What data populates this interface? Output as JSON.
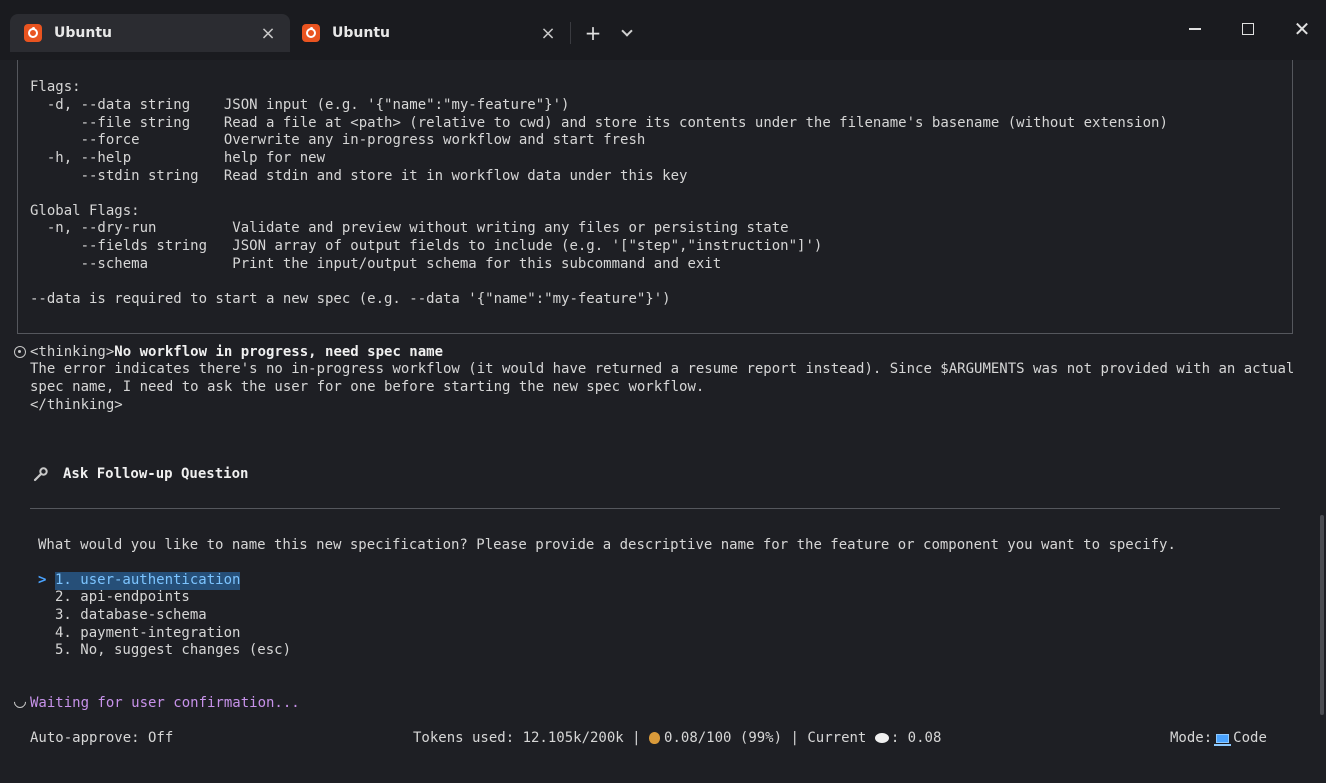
{
  "tabs": [
    {
      "label": "Ubuntu",
      "active": true,
      "icon": "ubuntu-icon"
    },
    {
      "label": "Ubuntu",
      "active": false,
      "icon": "ubuntu-icon"
    }
  ],
  "tab_controls": {
    "new_tab": "+",
    "close": "×",
    "window_close": "✕"
  },
  "help": {
    "flags_heading": "Flags:",
    "flags": [
      {
        "flag": "  -d, --data string    ",
        "desc": "JSON input (e.g. '{\"name\":\"my-feature\"}')"
      },
      {
        "flag": "      --file string    ",
        "desc": "Read a file at <path> (relative to cwd) and store its contents under the filename's basename (without extension)"
      },
      {
        "flag": "      --force          ",
        "desc": "Overwrite any in-progress workflow and start fresh"
      },
      {
        "flag": "  -h, --help           ",
        "desc": "help for new"
      },
      {
        "flag": "      --stdin string   ",
        "desc": "Read stdin and store it in workflow data under this key"
      }
    ],
    "global_heading": "Global Flags:",
    "global_flags": [
      {
        "flag": "  -n, --dry-run         ",
        "desc": "Validate and preview without writing any files or persisting state"
      },
      {
        "flag": "      --fields string   ",
        "desc": "JSON array of output fields to include (e.g. '[\"step\",\"instruction\"]')"
      },
      {
        "flag": "      --schema          ",
        "desc": "Print the input/output schema for this subcommand and exit"
      }
    ],
    "note": "--data is required to start a new spec (e.g. --data '{\"name\":\"my-feature\"}')"
  },
  "thinking": {
    "open_tag": "<thinking>",
    "title": "No workflow in progress, need spec name",
    "line1": "The error indicates there's no in-progress workflow (it would have returned a resume report instead). Since $ARGUMENTS was not provided with an actual",
    "line2": "spec name, I need to ask the user for one before starting the new spec workflow.",
    "close_tag": "</thinking>"
  },
  "followup": {
    "title": "Ask Follow-up Question",
    "question": "What would you like to name this new specification? Please provide a descriptive name for the feature or component you want to specify.",
    "selector": ">",
    "options": [
      "1. user-authentication",
      "2. api-endpoints",
      "3. database-schema",
      "4. payment-integration",
      "5. No, suggest changes (esc)"
    ]
  },
  "status": {
    "waiting": "Waiting for user confirmation...",
    "auto_approve": "Auto-approve: Off",
    "tokens": "Tokens used: 12.105k/200k",
    "separator": "|",
    "cost": "0.08/100 (99%)",
    "current_label": "Current",
    "current_value": ": 0.08",
    "mode_label": "Mode:",
    "mode_value": "Code"
  },
  "colors": {
    "accent": "#4aa3ff",
    "waiting": "#c792ea",
    "selection": "#264f78",
    "ubuntu": "#e95420"
  }
}
